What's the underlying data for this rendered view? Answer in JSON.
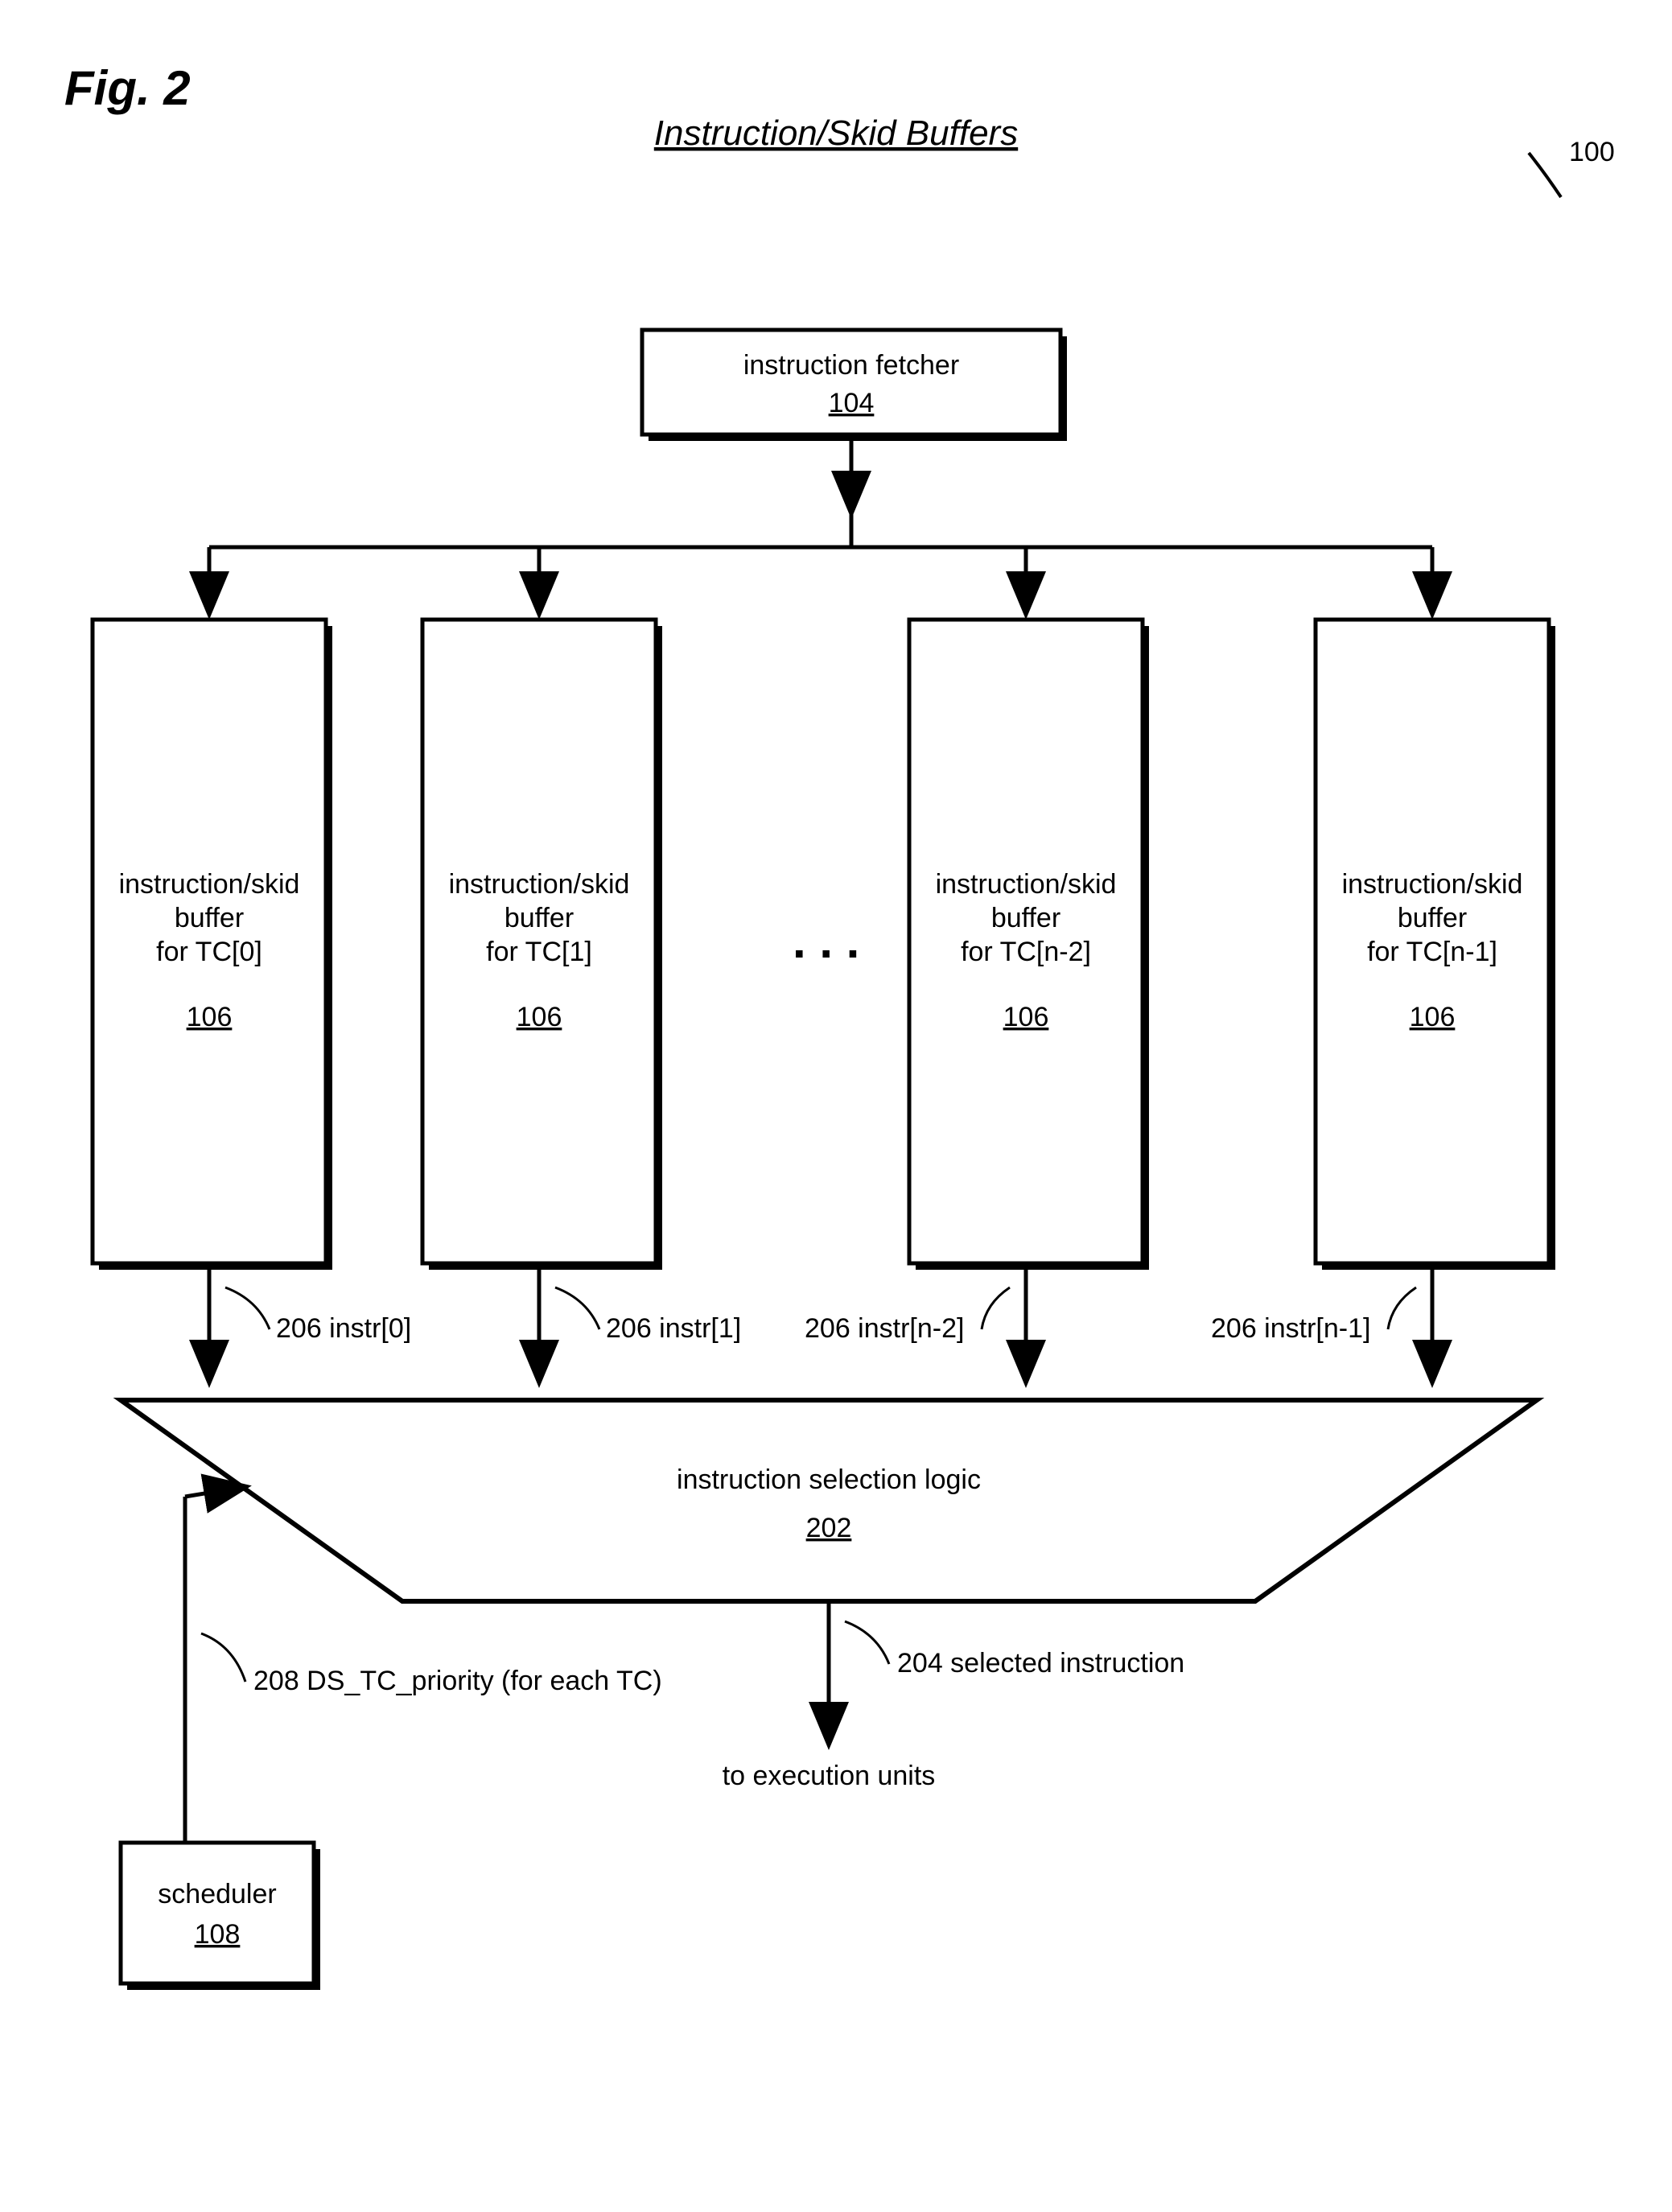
{
  "figure_label": "Fig. 2",
  "title": "Instruction/Skid Buffers",
  "ref_marker": "100",
  "fetcher": {
    "label": "instruction fetcher",
    "ref": "104"
  },
  "buffers": [
    {
      "line1": "instruction/skid",
      "line2": "buffer",
      "line3": "for TC[0]",
      "ref": "106",
      "out_label": "206  instr[0]"
    },
    {
      "line1": "instruction/skid",
      "line2": "buffer",
      "line3": "for TC[1]",
      "ref": "106",
      "out_label": "206  instr[1]"
    },
    {
      "line1": "instruction/skid",
      "line2": "buffer",
      "line3": "for TC[n-2]",
      "ref": "106",
      "out_label": "206  instr[n-2]"
    },
    {
      "line1": "instruction/skid",
      "line2": "buffer",
      "line3": "for TC[n-1]",
      "ref": "106",
      "out_label": "206  instr[n-1]"
    }
  ],
  "ellipsis": ". . .",
  "selection_logic": {
    "label": "instruction selection logic",
    "ref": "202"
  },
  "out_arrow": {
    "ref_label": "204  selected instruction",
    "target": "to execution units"
  },
  "scheduler": {
    "label": "scheduler",
    "ref": "108"
  },
  "priority_label": "208 DS_TC_priority (for each TC)"
}
